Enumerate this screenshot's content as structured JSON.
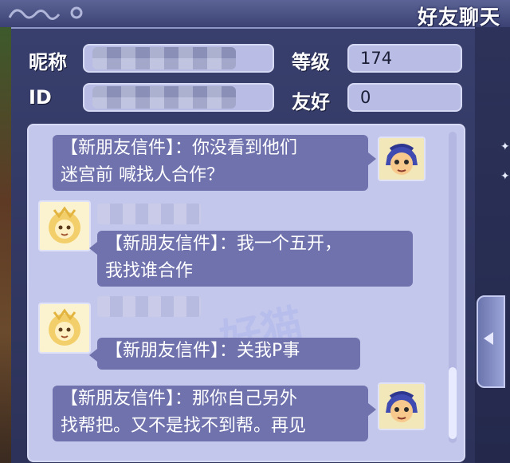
{
  "window": {
    "title": "好友聊天"
  },
  "profile": {
    "nickname_label": "昵称",
    "id_label": "ID",
    "level_label": "等级",
    "level_value": "174",
    "friendship_label": "友好",
    "friendship_value": "0"
  },
  "chat": {
    "watermark": "好猫",
    "messages": [
      {
        "side": "right",
        "avatar": "blue-hair-boy-avatar",
        "lines": [
          "【新朋友信件】：你没看到他们",
          "迷宫前 喊找人合作？"
        ]
      },
      {
        "side": "left",
        "avatar": "golden-lion-avatar",
        "lines": [
          "【新朋友信件】：我一个五开，",
          "我找谁合作"
        ]
      },
      {
        "side": "left",
        "avatar": "golden-lion-avatar",
        "lines": [
          "【新朋友信件】：关我P事"
        ]
      },
      {
        "side": "right",
        "avatar": "blue-hair-boy-avatar",
        "lines": [
          "【新朋友信件】：那你自己另外",
          "找帮把。又不是找不到帮。再见"
        ]
      }
    ]
  },
  "colors": {
    "bubble": "#6f72ad",
    "panel": "#c4c7ec",
    "field": "#b9bde6"
  }
}
